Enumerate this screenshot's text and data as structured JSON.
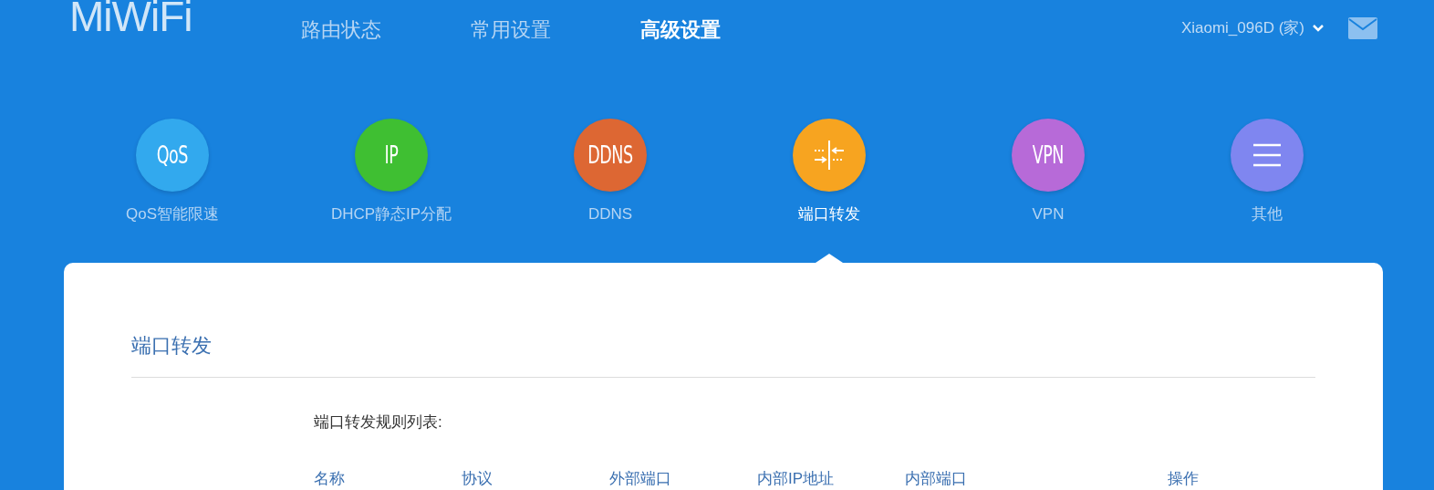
{
  "logo": "MiWiFi",
  "nav": [
    {
      "label": "路由状态",
      "selected": false
    },
    {
      "label": "常用设置",
      "selected": false
    },
    {
      "label": "高级设置",
      "selected": true
    }
  ],
  "account": {
    "label": "Xiaomi_096D (家)"
  },
  "tools": [
    {
      "kind": "text",
      "icon_text": "QoS",
      "color": "#32a9ee",
      "label": "QoS智能限速",
      "selected": false
    },
    {
      "kind": "text",
      "icon_text": "IP",
      "color": "#3fbf32",
      "label": "DHCP静态IP分配",
      "selected": false
    },
    {
      "kind": "text",
      "icon_text": "DDNS",
      "color": "#dd6733",
      "label": "DDNS",
      "selected": false
    },
    {
      "kind": "ports",
      "color": "#f7a420",
      "label": "端口转发",
      "selected": true
    },
    {
      "kind": "text",
      "icon_text": "VPN",
      "color": "#b76ad8",
      "label": "VPN",
      "selected": false
    },
    {
      "kind": "menu",
      "color": "#7f86f0",
      "label": "其他",
      "selected": false
    }
  ],
  "panel": {
    "title": "端口转发",
    "subtitle": "端口转发规则列表:",
    "columns": [
      "名称",
      "协议",
      "外部端口",
      "内部IP地址",
      "内部端口",
      "操作"
    ]
  }
}
